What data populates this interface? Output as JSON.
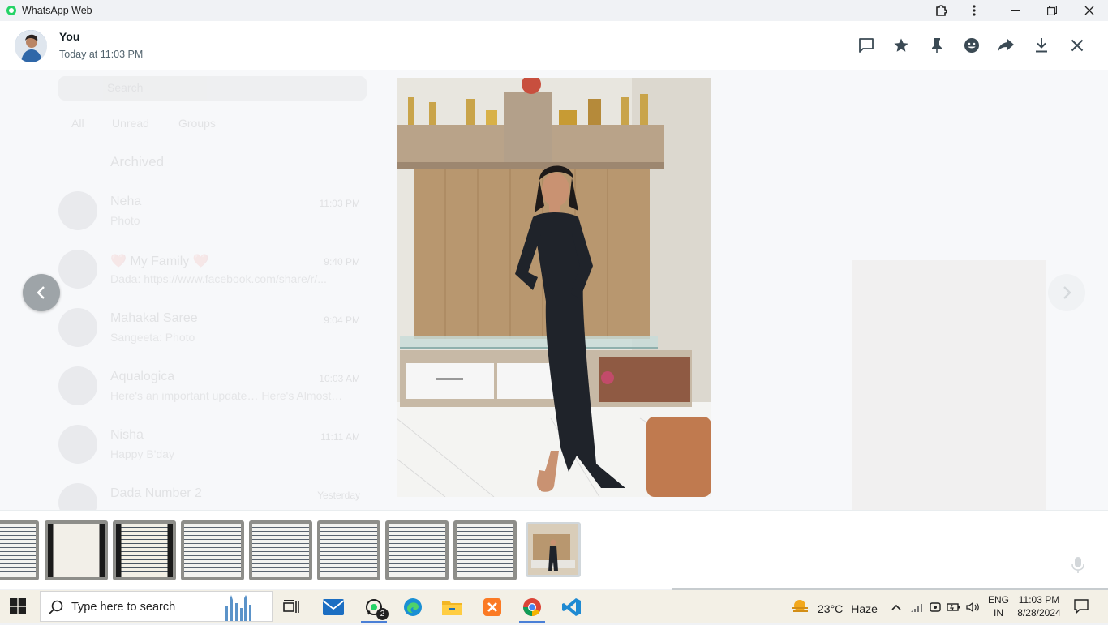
{
  "window": {
    "title": "WhatsApp Web"
  },
  "viewer": {
    "sender": "You",
    "timestamp": "Today at 11:03 PM"
  },
  "background_chat_list": {
    "search_placeholder": "Search",
    "filters": [
      "All",
      "Unread",
      "Groups"
    ],
    "archived_label": "Archived",
    "chats": [
      {
        "name": "Neha",
        "preview": "Photo",
        "time": "11:03 PM"
      },
      {
        "name": "❤️ My Family ❤️",
        "preview": "Dada: https://www.facebook.com/share/r/...",
        "time": "9:40 PM"
      },
      {
        "name": "Mahakal Saree",
        "preview": "Sangeeta: Photo",
        "time": "9:04 PM"
      },
      {
        "name": "Aqualogica",
        "preview": "Here's an important update… Here's Almost…",
        "time": "10:03 AM"
      },
      {
        "name": "Nisha",
        "preview": "Happy B'day",
        "time": "11:11 AM"
      },
      {
        "name": "Dada Number 2",
        "preview": "",
        "time": "Yesterday"
      }
    ]
  },
  "thumbnails": {
    "count": 9,
    "selected_index": 8
  },
  "taskbar": {
    "search_placeholder": "Type here to search",
    "whatsapp_badge": "2",
    "weather_temp": "23°C",
    "weather_condition": "Haze",
    "lang_line1": "ENG",
    "lang_line2": "IN",
    "time": "11:03 PM",
    "date": "8/28/2024"
  },
  "colors": {
    "accent": "#25d366",
    "header_bg": "#ffffff",
    "stage_bg": "#f7f8fa",
    "taskbar_bg": "#f3f0e6"
  },
  "icons": {
    "header": [
      "reply-icon",
      "star-icon",
      "pin-icon",
      "emoji-icon",
      "forward-icon",
      "download-icon",
      "close-icon"
    ]
  }
}
